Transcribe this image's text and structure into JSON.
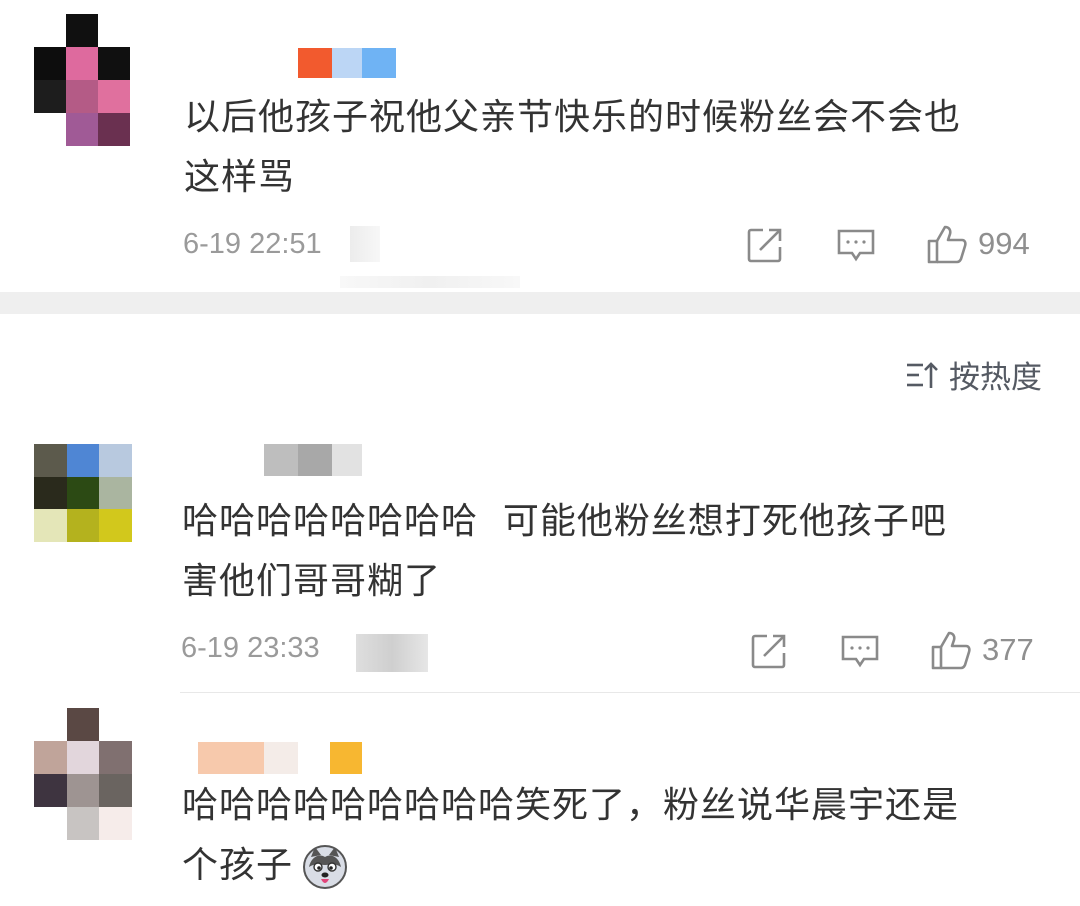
{
  "comments": [
    {
      "text_line1": "以后他孩子祝他父亲节快乐的时候粉丝会不会也",
      "text_line2": "这样骂",
      "time": "6-19 22:51",
      "likes": "994"
    },
    {
      "text_line1": "哈哈哈哈哈哈哈哈  可能他粉丝想打死他孩子吧",
      "text_line2": "害他们哥哥糊了",
      "time": "6-19 23:33",
      "likes": "377"
    },
    {
      "text_line1": "哈哈哈哈哈哈哈哈哈笑死了，粉丝说华晨宇还是",
      "text_line2": "个孩子"
    }
  ],
  "sort": {
    "label": "按热度"
  },
  "colors": {
    "text": "#333333",
    "meta": "#9a9a9a",
    "icon": "#8a8a8a",
    "band": "#efefef"
  }
}
